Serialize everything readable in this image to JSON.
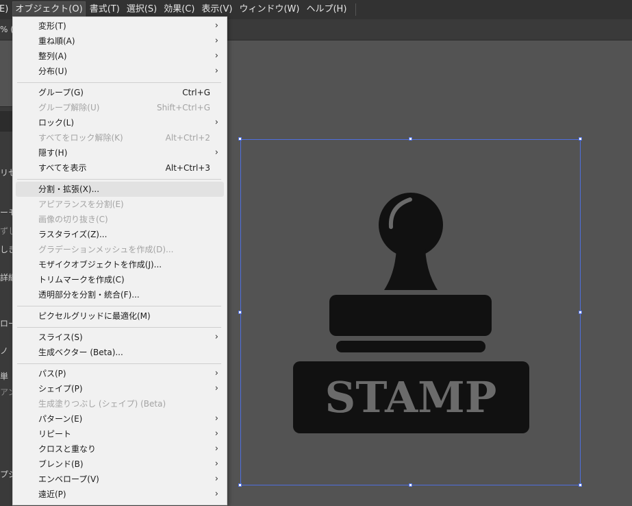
{
  "menubar": {
    "items": [
      {
        "label": "E)"
      },
      {
        "label": "オブジェクト(O)"
      },
      {
        "label": "書式(T)"
      },
      {
        "label": "選択(S)"
      },
      {
        "label": "効果(C)"
      },
      {
        "label": "表示(V)"
      },
      {
        "label": "ウィンドウ(W)"
      },
      {
        "label": "ヘルプ(H)"
      }
    ]
  },
  "tabbar": {
    "fragment": "% (R"
  },
  "left_panel": {
    "fragments": [
      "リセ",
      "ーモ",
      "ずし",
      "しき",
      "詳細",
      "ロー",
      "ノ",
      "単",
      "アン",
      "プジ"
    ]
  },
  "object_menu": {
    "items": [
      {
        "label": "変形(T)",
        "submenu": true
      },
      {
        "label": "重ね順(A)",
        "submenu": true
      },
      {
        "label": "整列(A)",
        "submenu": true
      },
      {
        "label": "分布(U)",
        "submenu": true
      },
      {
        "label": "グループ(G)",
        "shortcut": "Ctrl+G"
      },
      {
        "label": "グループ解除(U)",
        "shortcut": "Shift+Ctrl+G",
        "disabled": true
      },
      {
        "label": "ロック(L)",
        "submenu": true
      },
      {
        "label": "すべてをロック解除(K)",
        "shortcut": "Alt+Ctrl+2",
        "disabled": true
      },
      {
        "label": "隠す(H)",
        "submenu": true
      },
      {
        "label": "すべてを表示",
        "shortcut": "Alt+Ctrl+3"
      },
      {
        "label": "分割・拡張(X)...",
        "hover": true
      },
      {
        "label": "アピアランスを分割(E)",
        "disabled": true
      },
      {
        "label": "画像の切り抜き(C)",
        "disabled": true
      },
      {
        "label": "ラスタライズ(Z)..."
      },
      {
        "label": "グラデーションメッシュを作成(D)...",
        "disabled": true
      },
      {
        "label": "モザイクオブジェクトを作成(J)..."
      },
      {
        "label": "トリムマークを作成(C)"
      },
      {
        "label": "透明部分を分割・統合(F)..."
      },
      {
        "label": "ピクセルグリッドに最適化(M)"
      },
      {
        "label": "スライス(S)",
        "submenu": true
      },
      {
        "label": "生成ベクター (Beta)..."
      },
      {
        "label": "パス(P)",
        "submenu": true
      },
      {
        "label": "シェイプ(P)",
        "submenu": true
      },
      {
        "label": "生成塗りつぶし (シェイプ) (Beta)",
        "disabled": true
      },
      {
        "label": "パターン(E)",
        "submenu": true
      },
      {
        "label": "リピート",
        "submenu": true
      },
      {
        "label": "クロスと重なり",
        "submenu": true
      },
      {
        "label": "ブレンド(B)",
        "submenu": true
      },
      {
        "label": "エンベロープ(V)",
        "submenu": true
      },
      {
        "label": "遠近(P)",
        "submenu": true
      }
    ],
    "submenu_arrow": "›"
  },
  "artwork": {
    "stamp_text": "STAMP",
    "stamp_color": "#111111",
    "selection_color": "#4f6fe0"
  }
}
